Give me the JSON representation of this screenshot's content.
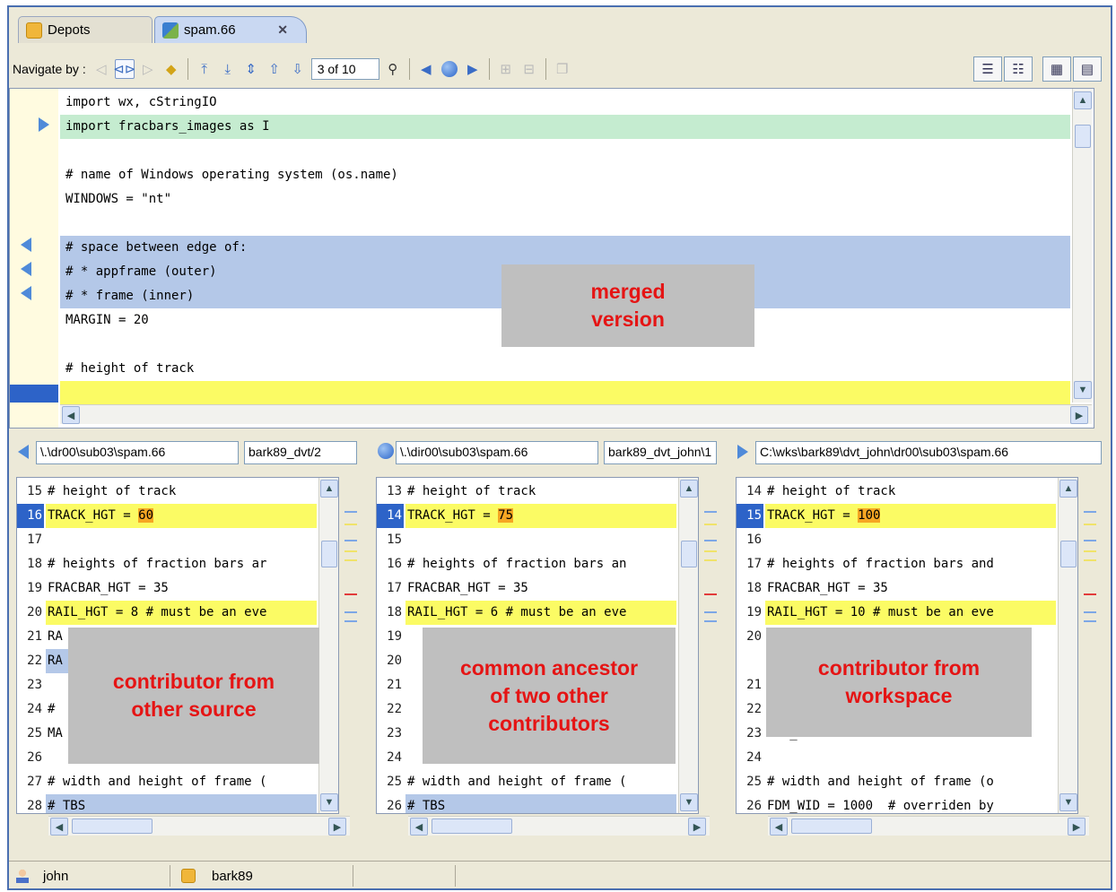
{
  "tabs": [
    {
      "label": "Depots",
      "icon": "database-icon"
    },
    {
      "label": "spam.66",
      "icon": "merge-icon"
    }
  ],
  "toolbar": {
    "navigate_label": "Navigate by :",
    "counter": "3 of 10"
  },
  "merged": {
    "lines": [
      {
        "text": "import wx, cStringIO",
        "bg": ""
      },
      {
        "text": "import fracbars_images as I",
        "bg": "green"
      },
      {
        "text": "",
        "bg": ""
      },
      {
        "text": "# name of Windows operating system (os.name)",
        "bg": ""
      },
      {
        "text": "WINDOWS = \"nt\"",
        "bg": ""
      },
      {
        "text": "",
        "bg": ""
      },
      {
        "text": "# space between edge of:",
        "bg": "blue"
      },
      {
        "text": "# * appframe (outer)",
        "bg": "blue"
      },
      {
        "text": "# * frame (inner)",
        "bg": "blue"
      },
      {
        "text": "MARGIN = 20",
        "bg": ""
      },
      {
        "text": "",
        "bg": ""
      },
      {
        "text": "# height of track",
        "bg": ""
      },
      {
        "text": "",
        "bg": "yellow"
      }
    ],
    "overlay": [
      "merged",
      "version"
    ]
  },
  "panes": [
    {
      "path": "\\.\\dr00\\sub03\\spam.66",
      "branch": "bark89_dvt/2",
      "icon": "left-arrow-icon",
      "lines": [
        {
          "n": "15",
          "t": "# height of track",
          "bg": ""
        },
        {
          "n": "16",
          "t": "TRACK_HGT = ",
          "hl": "60",
          "bg": "yellow",
          "cur": true
        },
        {
          "n": "17",
          "t": "",
          "bg": ""
        },
        {
          "n": "18",
          "t": "# heights of fraction bars ar",
          "bg": ""
        },
        {
          "n": "19",
          "t": "FRACBAR_HGT = 35",
          "bg": ""
        },
        {
          "n": "20",
          "t": "RAIL_HGT = 8 # must be an eve",
          "bg": "yellow"
        },
        {
          "n": "21",
          "t": "RA",
          "bg": ""
        },
        {
          "n": "22",
          "t": "RA",
          "bg": "blue"
        },
        {
          "n": "23",
          "t": "",
          "bg": ""
        },
        {
          "n": "24",
          "t": "#",
          "bg": ""
        },
        {
          "n": "25",
          "t": "MA",
          "bg": ""
        },
        {
          "n": "26",
          "t": "",
          "bg": ""
        },
        {
          "n": "27",
          "t": "# width and height of frame (",
          "bg": ""
        },
        {
          "n": "28",
          "t": "# TBS",
          "bg": "blue"
        }
      ],
      "overlay": [
        "contributor from",
        "other source"
      ]
    },
    {
      "path": "\\.\\dir00\\sub03\\spam.66",
      "branch": "bark89_dvt_john\\1",
      "icon": "circle-icon",
      "lines": [
        {
          "n": "13",
          "t": "# height of track",
          "bg": ""
        },
        {
          "n": "14",
          "t": "TRACK_HGT = ",
          "hl": "75",
          "bg": "yellow",
          "cur": true
        },
        {
          "n": "15",
          "t": "",
          "bg": ""
        },
        {
          "n": "16",
          "t": "# heights of fraction bars an",
          "bg": ""
        },
        {
          "n": "17",
          "t": "FRACBAR_HGT = 35",
          "bg": ""
        },
        {
          "n": "18",
          "t": "RAIL_HGT = 6 # must be an eve",
          "bg": "yellow"
        },
        {
          "n": "19",
          "t": "",
          "bg": ""
        },
        {
          "n": "20",
          "t": "",
          "bg": "blue"
        },
        {
          "n": "21",
          "t": "",
          "bg": ""
        },
        {
          "n": "22",
          "t": "",
          "bg": ""
        },
        {
          "n": "23",
          "t": "",
          "bg": ""
        },
        {
          "n": "24",
          "t": "",
          "bg": ""
        },
        {
          "n": "25",
          "t": "# width and height of frame (",
          "bg": ""
        },
        {
          "n": "26",
          "t": "# TBS",
          "bg": "blue"
        }
      ],
      "overlay": [
        "common ancestor",
        "of two other",
        "contributors"
      ]
    },
    {
      "path": "C:\\wks\\bark89\\dvt_john\\dr00\\sub03\\spam.66",
      "branch": "",
      "icon": "right-arrow-icon",
      "lines": [
        {
          "n": "14",
          "t": "# height of track",
          "bg": ""
        },
        {
          "n": "15",
          "t": "TRACK_HGT = ",
          "hl": "100",
          "bg": "yellow",
          "cur": true
        },
        {
          "n": "16",
          "t": "",
          "bg": ""
        },
        {
          "n": "17",
          "t": "# heights of fraction bars and",
          "bg": ""
        },
        {
          "n": "18",
          "t": "FRACBAR_HGT = 35",
          "bg": ""
        },
        {
          "n": "19",
          "t": "RAIL_HGT = 10 # must be an eve",
          "bg": "yellow"
        },
        {
          "n": "20",
          "t": "R",
          "bg": ""
        },
        {
          "n": "",
          "t": "",
          "bg": "salmon"
        },
        {
          "n": "21",
          "t": "",
          "bg": ""
        },
        {
          "n": "22",
          "t": "#",
          "bg": ""
        },
        {
          "n": "23",
          "t": "MAX_RSLNR = 72",
          "bg": ""
        },
        {
          "n": "24",
          "t": "",
          "bg": ""
        },
        {
          "n": "25",
          "t": "# width and height of frame (o",
          "bg": ""
        },
        {
          "n": "26",
          "t": "FDM_WID = 1000  # overriden by",
          "bg": ""
        }
      ],
      "overlay": [
        "contributor from",
        "workspace"
      ]
    }
  ],
  "status": {
    "user": "john",
    "stream": "bark89"
  },
  "colors": {
    "green": "#c5ecd0",
    "blue": "#b4c8e8",
    "yellow": "#fbfb64",
    "salmon": "#f7b39e",
    "overlay_text": "#e51414"
  }
}
